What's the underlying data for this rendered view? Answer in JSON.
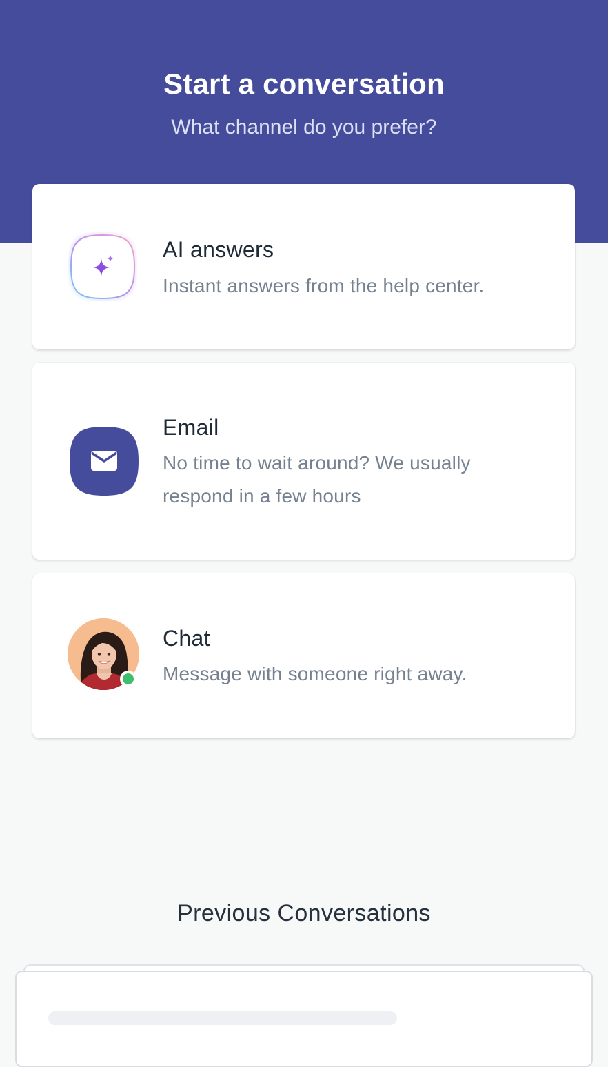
{
  "header": {
    "title": "Start a conversation",
    "subtitle": "What channel do you prefer?",
    "background_color": "#464c9c"
  },
  "channels": [
    {
      "id": "ai",
      "title": "AI answers",
      "description": "Instant answers from the help center.",
      "icon": "sparkles-icon"
    },
    {
      "id": "email",
      "title": "Email",
      "description": "No time to wait around? We usually respond in a few hours",
      "icon": "envelope-icon"
    },
    {
      "id": "chat",
      "title": "Chat",
      "description": "Message with someone right away.",
      "icon": "agent-avatar",
      "status": "online",
      "status_color": "#3fbf6b"
    }
  ],
  "previous": {
    "title": "Previous Conversations"
  }
}
